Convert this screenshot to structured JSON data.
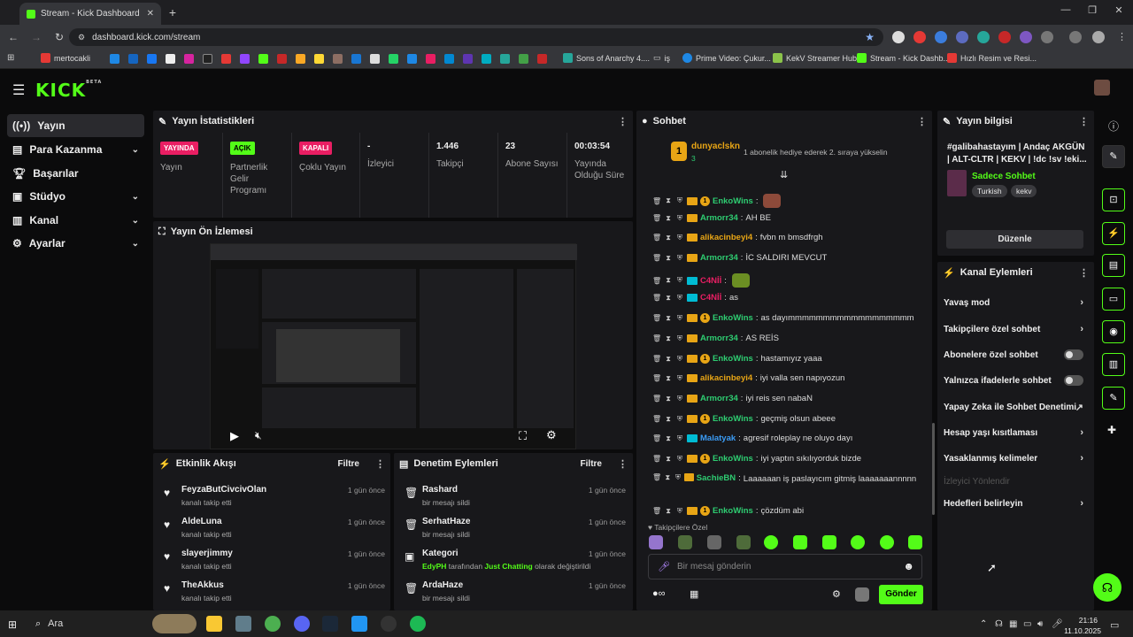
{
  "browser": {
    "tab_title": "Stream - Kick Dashboard",
    "url": "dashboard.kick.com/stream",
    "bookmarks": [
      "mertocakli",
      "Sons of Anarchy 4....",
      "iş",
      "Prime Video: Çukur...",
      "KekV Streamer Hub",
      "Stream - Kick Dashb...",
      "Hızlı Resim ve Resi..."
    ]
  },
  "brand": {
    "logo": "KICK",
    "logo_tag": "BETA",
    "accent": "#53fc18"
  },
  "sidebar": {
    "items": [
      {
        "label": "Yayın",
        "icon": "broadcast-icon",
        "active": true
      },
      {
        "label": "Para Kazanma",
        "icon": "money-icon",
        "expandable": true
      },
      {
        "label": "Başarılar",
        "icon": "trophy-icon"
      },
      {
        "label": "Stüdyo",
        "icon": "studio-icon",
        "expandable": true
      },
      {
        "label": "Kanal",
        "icon": "channel-icon",
        "expandable": true
      },
      {
        "label": "Ayarlar",
        "icon": "gear-icon",
        "expandable": true
      }
    ]
  },
  "stats": {
    "title": "Yayın İstatistikleri",
    "cols": [
      {
        "badge": "YAYINDA",
        "badge_color": "#e91e63",
        "label": "Yayın"
      },
      {
        "badge": "AÇIK",
        "badge_color": "#53fc18",
        "label": "Partnerlik Gelir Programı"
      },
      {
        "badge": "KAPALI",
        "badge_color": "#e91e63",
        "label": "Çoklu Yayın"
      },
      {
        "value": "-",
        "label": "İzleyici"
      },
      {
        "value": "1.446",
        "label": "Takipçi"
      },
      {
        "value": "23",
        "label": "Abone Sayısı"
      },
      {
        "value": "00:03:54",
        "label": "Yayında Olduğu Süre"
      }
    ]
  },
  "preview": {
    "title": "Yayın Ön İzlemesi"
  },
  "activity": {
    "title": "Etkinlik Akışı",
    "filter": "Filtre",
    "items": [
      {
        "name": "FeyzaButCivcivOlan",
        "sub": "kanalı takip etti",
        "time": "1 gün önce"
      },
      {
        "name": "AldeLuna",
        "sub": "kanalı takip etti",
        "time": "1 gün önce"
      },
      {
        "name": "slayerjimmy",
        "sub": "kanalı takip etti",
        "time": "1 gün önce"
      },
      {
        "name": "TheAkkus",
        "sub": "kanalı takip etti",
        "time": "1 gün önce"
      }
    ]
  },
  "moderation": {
    "title": "Denetim Eylemleri",
    "filter": "Filtre",
    "items": [
      {
        "name": "Rashard",
        "sub": "bir mesajı sildi",
        "time": "1 gün önce"
      },
      {
        "name": "SerhatHaze",
        "sub": "bir mesajı sildi",
        "time": "1 gün önce"
      },
      {
        "name": "Kategori",
        "sub_user": "EdyPH",
        "sub_mid": " tarafından ",
        "sub_cat": "Just Chatting",
        "sub_end": " olarak değiştirildi",
        "time": "1 gün önce"
      },
      {
        "name": "ArdaHaze",
        "sub": "bir mesajı sildi",
        "time": "1 gün önce"
      }
    ]
  },
  "chat": {
    "title": "Sohbet",
    "pinned_user": "dunyaclskn",
    "pinned_count": "3",
    "pinned_text": "1 abonelik hediye ederek 2. sıraya yükselin",
    "messages": [
      {
        "user": "EnkoWins",
        "color": "#2ecc71",
        "text": "",
        "sub": true
      },
      {
        "user": "Armorr34",
        "color": "#2ecc71",
        "text": "AH BE"
      },
      {
        "user": "alikacinbeyi4",
        "color": "#e8a515",
        "text": "fvbn m bmsdfrgh"
      },
      {
        "user": "Armorr34",
        "color": "#2ecc71",
        "text": "İC SALDIRI MEVCUT"
      },
      {
        "user": "C4Nİİ",
        "color": "#e91e63",
        "text": ""
      },
      {
        "user": "C4Nİİ",
        "color": "#e91e63",
        "text": "as"
      },
      {
        "user": "EnkoWins",
        "color": "#2ecc71",
        "text": "as dayımmmmmmmmmmmmmmmmmm",
        "sub": true
      },
      {
        "user": "Armorr34",
        "color": "#2ecc71",
        "text": "AS REİS"
      },
      {
        "user": "EnkoWins",
        "color": "#2ecc71",
        "text": "hastamıyız yaaa",
        "sub": true
      },
      {
        "user": "alikacinbeyi4",
        "color": "#e8a515",
        "text": "iyi valla sen napıyozun"
      },
      {
        "user": "Armorr34",
        "color": "#2ecc71",
        "text": "iyi reis sen nabaN"
      },
      {
        "user": "EnkoWins",
        "color": "#2ecc71",
        "text": "geçmiş olsun abeee",
        "sub": true
      },
      {
        "user": "Malatyak",
        "color": "#3b9cf5",
        "text": "agresif roleplay ne oluyo dayı"
      },
      {
        "user": "EnkoWins",
        "color": "#2ecc71",
        "text": "iyi yaptın sıkılıyorduk bizde",
        "sub": true
      },
      {
        "user": "SachieBN",
        "color": "#2ecc71",
        "text": "Laaaaaan iş paslayıcım gitmiş laaaaaaannnnn"
      },
      {
        "user": "EnkoWins",
        "color": "#2ecc71",
        "text": "çözdüm abi",
        "sub": true
      }
    ],
    "followers_only": "Takipçilere Özel",
    "input_placeholder": "Bir mesaj gönderin",
    "send": "Gönder"
  },
  "stream_info": {
    "title": "Yayın bilgisi",
    "stream_title": "#galibahastayım | Andaç AKGÜN | ALT-CLTR | KEKV | !dc !sv !eki...",
    "category": "Sadece Sohbet",
    "tags": [
      "Turkish",
      "kekv"
    ],
    "edit": "Düzenle"
  },
  "channel_actions": {
    "title": "Kanal Eylemleri",
    "items": [
      {
        "label": "Yavaş mod",
        "kind": "chevron"
      },
      {
        "label": "Takipçilere özel sohbet",
        "kind": "chevron"
      },
      {
        "label": "Abonelere özel sohbet",
        "kind": "toggle"
      },
      {
        "label": "Yalnızca ifadelerle sohbet",
        "kind": "toggle"
      },
      {
        "label": "Yapay Zeka ile Sohbet Denetimi",
        "kind": "external"
      },
      {
        "label": "Hesap yaşı kısıtlaması",
        "kind": "chevron"
      },
      {
        "label": "Yasaklanmış kelimeler",
        "kind": "chevron"
      },
      {
        "label": "İzleyici Yönlendir",
        "kind": "disabled"
      },
      {
        "label": "Hedefleri belirleyin",
        "kind": "chevron"
      }
    ]
  },
  "taskbar": {
    "search": "Ara",
    "time": "21:16",
    "date": "11.10.2025"
  }
}
